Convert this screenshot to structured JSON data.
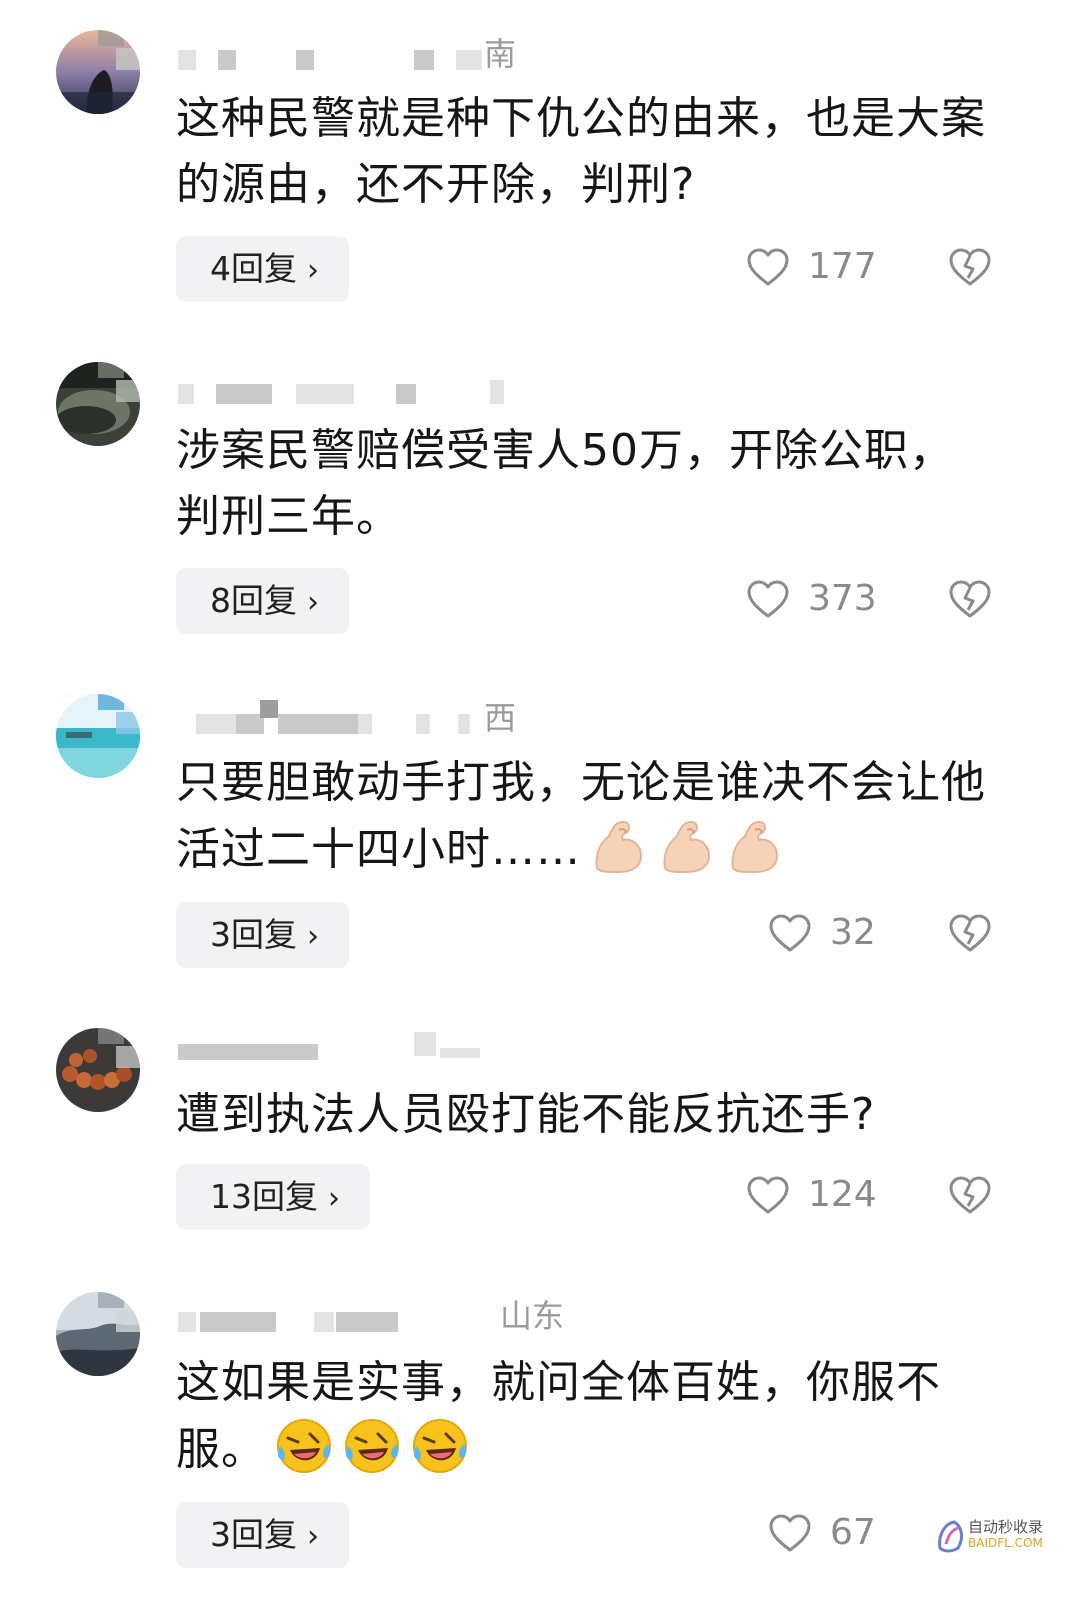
{
  "comments": [
    {
      "region": "南",
      "text": "这种民警就是种下仇公的由来，也是大案的源由，还不开除，判刑?",
      "replies": "4回复",
      "likes": "177"
    },
    {
      "region": "",
      "text": "涉案民警赔偿受害人50万，开除公职，判刑三年。",
      "replies": "8回复",
      "likes": "373"
    },
    {
      "region": "西",
      "text": "只要胆敢动手打我，无论是谁决不会让他活过二十四小时……",
      "emoji_icons": [
        "flexed-biceps-icon",
        "flexed-biceps-icon",
        "flexed-biceps-icon"
      ],
      "replies": "3回复",
      "likes": "32"
    },
    {
      "region": "",
      "text": "遭到执法人员殴打能不能反抗还手?",
      "replies": "13回复",
      "likes": "124"
    },
    {
      "region": "山东",
      "text": "这如果是实事，就问全体百姓，你服不服。",
      "emoji_icons": [
        "rolling-laughing-icon",
        "rolling-laughing-icon",
        "rolling-laughing-icon"
      ],
      "replies": "3回复",
      "likes": "67"
    }
  ],
  "reply_chevron": "›",
  "watermark": {
    "line1": "自动秒收录",
    "line2": "BAIDFL.COM"
  },
  "colors": {
    "text": "#161616",
    "meta": "#9b9b9b",
    "reply_bg": "#f2f2f4",
    "icon_stroke": "#8a8a8a"
  }
}
